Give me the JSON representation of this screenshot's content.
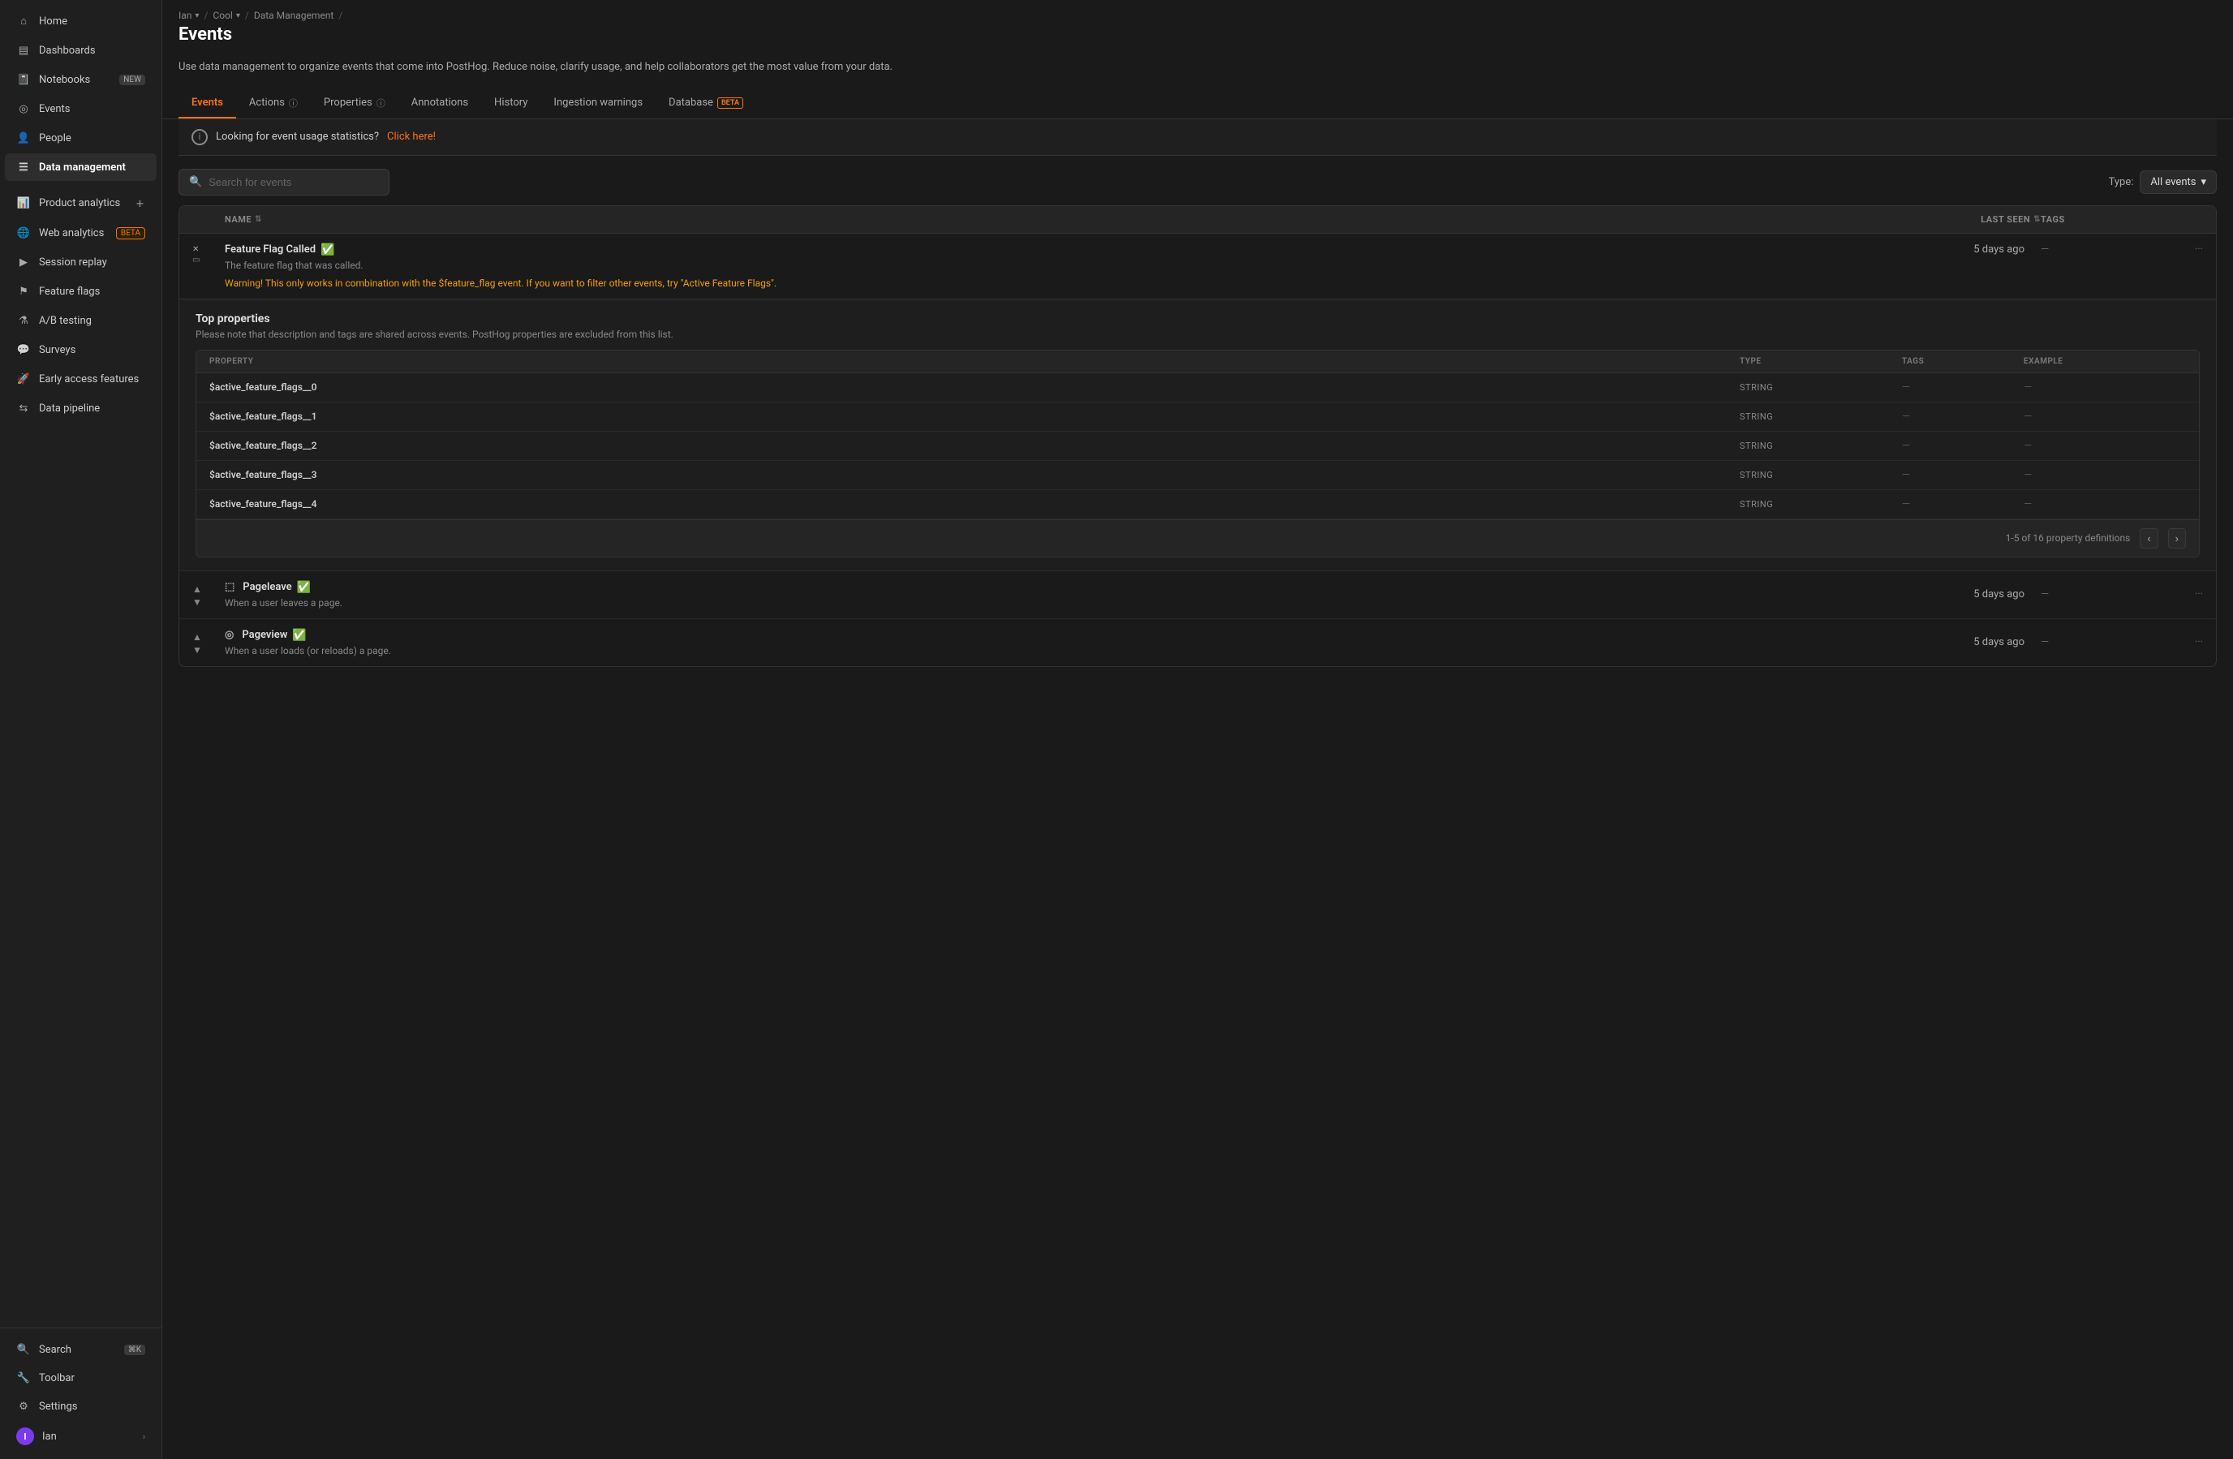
{
  "sidebar": {
    "items": [
      {
        "id": "home",
        "label": "Home",
        "icon": "home",
        "active": false
      },
      {
        "id": "dashboards",
        "label": "Dashboards",
        "icon": "dashboard",
        "active": false
      },
      {
        "id": "notebooks",
        "label": "Notebooks",
        "icon": "notebook",
        "badge": "NEW",
        "active": false
      },
      {
        "id": "events",
        "label": "Events",
        "icon": "events",
        "active": false
      },
      {
        "id": "people",
        "label": "People",
        "icon": "people",
        "active": false
      },
      {
        "id": "data-management",
        "label": "Data management",
        "icon": "data",
        "active": true
      },
      {
        "id": "product-analytics",
        "label": "Product analytics",
        "icon": "analytics",
        "active": false,
        "hasAdd": true
      },
      {
        "id": "web-analytics",
        "label": "Web analytics",
        "icon": "web",
        "badge": "BETA",
        "active": false
      },
      {
        "id": "session-replay",
        "label": "Session replay",
        "icon": "replay",
        "active": false
      },
      {
        "id": "feature-flags",
        "label": "Feature flags",
        "icon": "flags",
        "active": false
      },
      {
        "id": "ab-testing",
        "label": "A/B testing",
        "icon": "ab",
        "active": false
      },
      {
        "id": "surveys",
        "label": "Surveys",
        "icon": "surveys",
        "active": false
      },
      {
        "id": "early-access",
        "label": "Early access features",
        "icon": "early",
        "active": false
      },
      {
        "id": "data-pipeline",
        "label": "Data pipeline",
        "icon": "pipeline",
        "active": false
      }
    ],
    "bottom": [
      {
        "id": "search",
        "label": "Search",
        "icon": "search",
        "shortcut": "⌘K"
      },
      {
        "id": "toolbar",
        "label": "Toolbar",
        "icon": "toolbar"
      },
      {
        "id": "settings",
        "label": "Settings",
        "icon": "settings"
      }
    ],
    "user": {
      "label": "Ian",
      "initial": "I"
    }
  },
  "breadcrumb": {
    "parts": [
      {
        "label": "Ian",
        "hasDropdown": true
      },
      {
        "label": "Cool",
        "hasDropdown": true
      },
      {
        "label": "Data Management",
        "hasDropdown": false
      }
    ],
    "current": "Events"
  },
  "page": {
    "title": "Events",
    "description": "Use data management to organize events that come into PostHog. Reduce noise, clarify usage, and help collaborators get the most value from your data."
  },
  "tabs": [
    {
      "id": "events",
      "label": "Events",
      "active": true,
      "hasInfo": false
    },
    {
      "id": "actions",
      "label": "Actions",
      "active": false,
      "hasInfo": true
    },
    {
      "id": "properties",
      "label": "Properties",
      "active": false,
      "hasInfo": true
    },
    {
      "id": "annotations",
      "label": "Annotations",
      "active": false
    },
    {
      "id": "history",
      "label": "History",
      "active": false
    },
    {
      "id": "ingestion-warnings",
      "label": "Ingestion warnings",
      "active": false
    },
    {
      "id": "database",
      "label": "Database",
      "active": false,
      "hasBeta": true
    }
  ],
  "banner": {
    "text": "Looking for event usage statistics?",
    "link_text": "Click here!"
  },
  "search": {
    "placeholder": "Search for events"
  },
  "type_filter": {
    "label": "Type:",
    "value": "All events"
  },
  "table": {
    "headers": {
      "name": "NAME",
      "last_seen": "LAST SEEN",
      "tags": "TAGS"
    },
    "events": [
      {
        "name": "Feature Flag Called",
        "description": "The feature flag that was called.",
        "warning": "Warning! This only works in combination with the $feature_flag event. If you want to filter other events, try \"Active Feature Flags\".",
        "last_seen": "5 days ago",
        "tags": "—",
        "verified": true,
        "expanded": true
      },
      {
        "name": "Pageleave",
        "description": "When a user leaves a page.",
        "last_seen": "5 days ago",
        "tags": "—",
        "verified": true,
        "expanded": false
      },
      {
        "name": "Pageview",
        "description": "When a user loads (or reloads) a page.",
        "last_seen": "5 days ago",
        "tags": "—",
        "verified": true,
        "expanded": false
      }
    ]
  },
  "expanded_panel": {
    "title": "Top properties",
    "description": "Please note that description and tags are shared across events. PostHog properties are excluded from this list.",
    "headers": {
      "property": "PROPERTY",
      "type": "TYPE",
      "tags": "TAGS",
      "example": "EXAMPLE"
    },
    "properties": [
      {
        "name": "$active_feature_flags__0",
        "type": "STRING",
        "tags": "—",
        "example": "—"
      },
      {
        "name": "$active_feature_flags__1",
        "type": "STRING",
        "tags": "—",
        "example": "—"
      },
      {
        "name": "$active_feature_flags__2",
        "type": "STRING",
        "tags": "—",
        "example": "—"
      },
      {
        "name": "$active_feature_flags__3",
        "type": "STRING",
        "tags": "—",
        "example": "—"
      },
      {
        "name": "$active_feature_flags__4",
        "type": "STRING",
        "tags": "—",
        "example": "—"
      }
    ],
    "pagination": {
      "text": "1-5 of 16 property definitions"
    }
  },
  "colors": {
    "accent": "#f97316",
    "verified_green": "#4ade80",
    "sidebar_active_bg": "#2d2d2d",
    "border": "#333333"
  }
}
